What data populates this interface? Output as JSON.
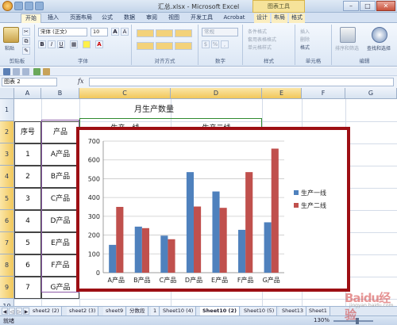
{
  "window": {
    "title": "汇总.xlsx - Microsoft Excel",
    "context_tab": "图表工具"
  },
  "ribbon_tabs": [
    "开始",
    "插入",
    "页面布局",
    "公式",
    "数据",
    "审阅",
    "视图",
    "开发工具",
    "Acrobat",
    "设计",
    "布局",
    "格式"
  ],
  "ribbon": {
    "clipboard": {
      "paste": "粘贴",
      "label": "剪贴板"
    },
    "font": {
      "family": "宋体 (正文)",
      "size": "10",
      "label": "字体",
      "bold": "B",
      "italic": "I",
      "underline": "U",
      "grow": "A",
      "shrink": "A"
    },
    "alignment": {
      "label": "对齐方式"
    },
    "number": {
      "format": "常规",
      "label": "数字"
    },
    "styles": {
      "conditional": "条件格式",
      "table": "套用表格格式",
      "cell": "单元格样式",
      "label": "样式"
    },
    "cells": {
      "insert": "插入",
      "delete": "删除",
      "format": "格式",
      "label": "单元格"
    },
    "editing": {
      "sort": "排序和筛选",
      "find": "查找和选择",
      "label": "编辑"
    }
  },
  "formula_bar": {
    "name_box": "图表 2",
    "fx": "fx",
    "formula": ""
  },
  "columns": [
    "A",
    "B",
    "C",
    "D",
    "E",
    "F",
    "G"
  ],
  "rows": [
    "1",
    "2",
    "3",
    "4",
    "5",
    "6",
    "7",
    "8",
    "9",
    "10"
  ],
  "sheet": {
    "title": "月生产数量",
    "headers": [
      "序号",
      "产品",
      "生产一线",
      "生产二线"
    ],
    "index": [
      "1",
      "2",
      "3",
      "4",
      "5",
      "6",
      "7"
    ],
    "products": [
      "A产品",
      "B产品",
      "C产品",
      "D产品",
      "E产品",
      "F产品",
      "G产品"
    ]
  },
  "chart_data": {
    "type": "bar",
    "categories": [
      "A产品",
      "B产品",
      "C产品",
      "D产品",
      "E产品",
      "F产品",
      "G产品"
    ],
    "series": [
      {
        "name": "生产一线",
        "values": [
          148,
          245,
          197,
          535,
          432,
          228,
          268
        ],
        "color": "#4f81bd"
      },
      {
        "name": "生产二线",
        "values": [
          350,
          237,
          178,
          352,
          345,
          535,
          660
        ],
        "color": "#c0504d"
      }
    ],
    "ylim": [
      0,
      700
    ],
    "yticks": [
      "0",
      "100",
      "200",
      "300",
      "400",
      "500",
      "600",
      "700"
    ],
    "grid": true,
    "legend_position": "right"
  },
  "sheet_tabs": [
    "sheet2 (2)",
    "sheet2 (3)",
    "sheet9",
    "分数段",
    "1",
    "Sheet10 (4)",
    "Sheet10 (2)",
    "Sheet10 (5)",
    "Sheet13",
    "Sheet1"
  ],
  "active_sheet_index": 6,
  "status": {
    "mode": "就绪",
    "zoom": "130%"
  },
  "watermark": {
    "text": "Baidu经验",
    "sub": "jingyan.baidu.com"
  }
}
